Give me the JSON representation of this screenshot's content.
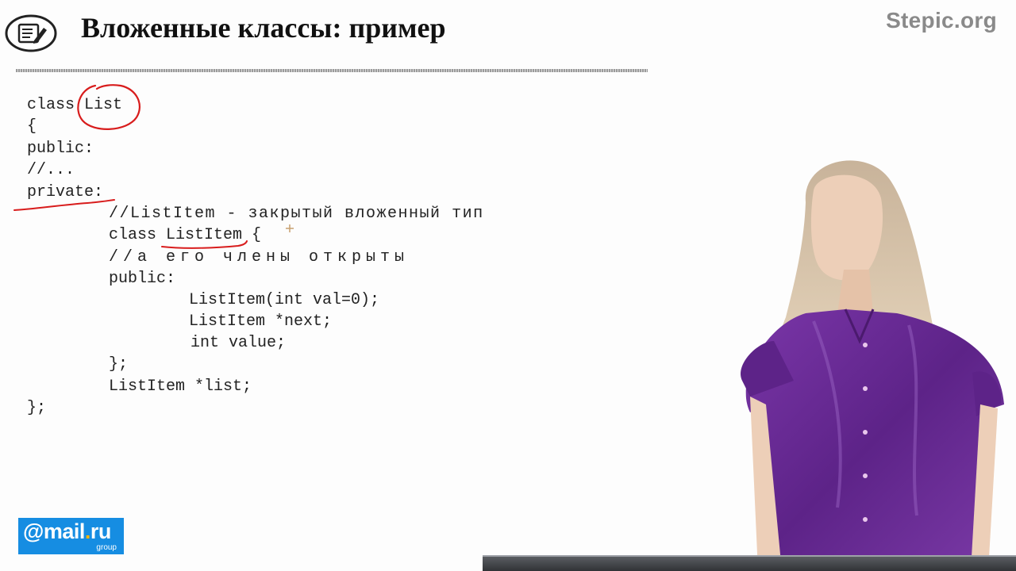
{
  "header": {
    "title": "Вложенные классы: пример",
    "brand": "Stepic.org",
    "icon": "notepad-pencil-icon"
  },
  "code": {
    "lines": [
      "class List",
      "{",
      "public:",
      "//...",
      "private:",
      "//ListItem - закрытый вложенный тип",
      "class ListItem {",
      "//а его члены открыты",
      "public:",
      "ListItem(int val=0);",
      "ListItem *next;",
      "int value;",
      "};",
      "ListItem *list;",
      "};"
    ]
  },
  "logo": {
    "main": "@mail",
    "dot": ".",
    "tld": "ru",
    "sub": "group"
  },
  "colors": {
    "annotation": "#d81c1c",
    "logo_bg": "#168de2",
    "logo_dot": "#ffb400",
    "brand": "#8a8a8a",
    "shirt": "#6b2a97"
  }
}
